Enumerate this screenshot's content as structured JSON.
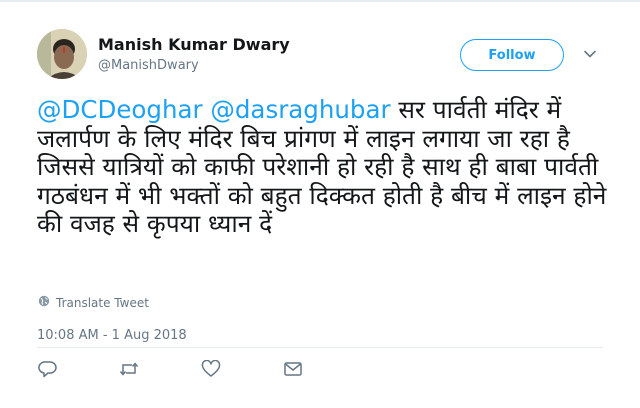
{
  "tweet": {
    "author_name": "Manish Kumar Dwary",
    "author_handle": "@ManishDwary",
    "follow_label": "Follow",
    "mentions": [
      "@DCDeoghar",
      "@dasraghubar"
    ],
    "body_text": "सर पार्वती मंदिर में जलार्पण के लिए मंदिर बिच प्रांगण में लाइन लगाया जा रहा है जिससे यात्रियों को काफी परेशानी हो रही है साथ ही बाबा पार्वती गठबंधन में भी भक्तों को बहुत दिक्कत होती है बीच में लाइन होने की वजह से कृपया ध्यान दें",
    "translate_label": "Translate Tweet",
    "timestamp": "10:08 AM - 1 Aug 2018"
  },
  "icons": {
    "avatar": "avatar",
    "caret": "chevron-down-icon",
    "translate": "globe-icon",
    "reply": "reply-icon",
    "retweet": "retweet-icon",
    "like": "heart-icon",
    "message": "envelope-icon"
  },
  "colors": {
    "accent": "#1da1f2",
    "text": "#14171a",
    "muted": "#657786",
    "divider": "#e6ecf0"
  }
}
